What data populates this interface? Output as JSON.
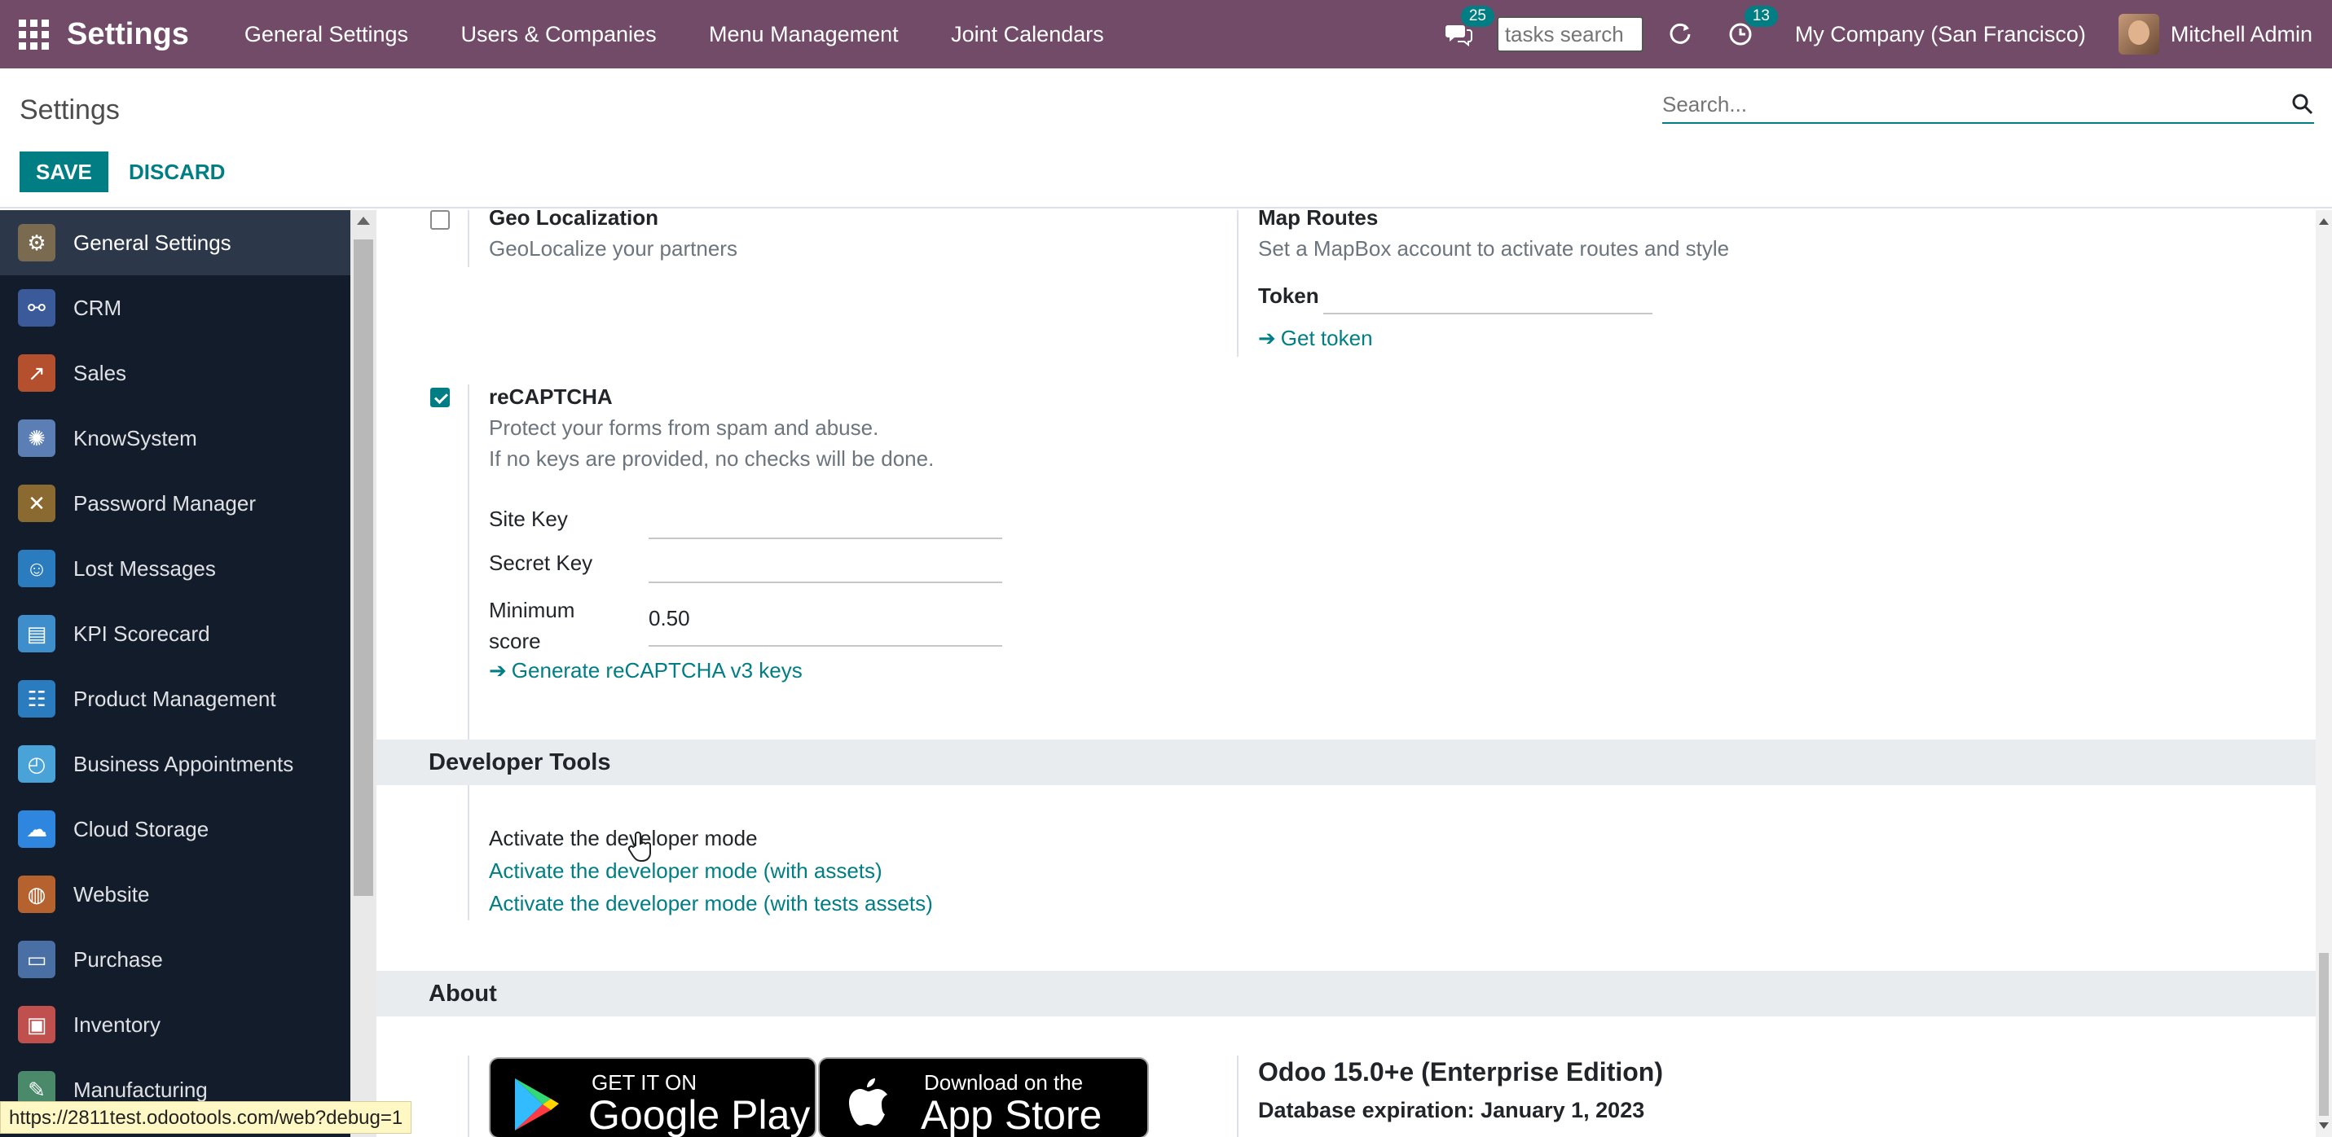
{
  "navbar": {
    "app_title": "Settings",
    "menu": [
      "General Settings",
      "Users & Companies",
      "Menu Management",
      "Joint Calendars"
    ],
    "messages_count": "25",
    "tasks_search_placeholder": "tasks search",
    "activities_count": "13",
    "company": "My Company (San Francisco)",
    "user": "Mitchell Admin"
  },
  "control_panel": {
    "breadcrumb": "Settings",
    "search_placeholder": "Search...",
    "save_label": "SAVE",
    "discard_label": "DISCARD"
  },
  "sidebar": {
    "items": [
      {
        "label": "General Settings",
        "icon": "gear-icon",
        "color": "#7a6a4f",
        "active": true
      },
      {
        "label": "CRM",
        "icon": "handshake-icon",
        "color": "#3a5a9a"
      },
      {
        "label": "Sales",
        "icon": "chart-icon",
        "color": "#b5502e"
      },
      {
        "label": "KnowSystem",
        "icon": "brain-icon",
        "color": "#5b7fb5"
      },
      {
        "label": "Password Manager",
        "icon": "tools-icon",
        "color": "#8a6a30"
      },
      {
        "label": "Lost Messages",
        "icon": "person-icon",
        "color": "#2b7bbf"
      },
      {
        "label": "KPI Scorecard",
        "icon": "clipboard-icon",
        "color": "#3e8ecb"
      },
      {
        "label": "Product Management",
        "icon": "sliders-icon",
        "color": "#2b7bbf"
      },
      {
        "label": "Business Appointments",
        "icon": "clock-icon",
        "color": "#4aa3d8"
      },
      {
        "label": "Cloud Storage",
        "icon": "cloud-icon",
        "color": "#2e86de"
      },
      {
        "label": "Website",
        "icon": "globe-icon",
        "color": "#b5622e"
      },
      {
        "label": "Purchase",
        "icon": "card-icon",
        "color": "#4a6fa5"
      },
      {
        "label": "Inventory",
        "icon": "box-icon",
        "color": "#c0504d"
      },
      {
        "label": "Manufacturing",
        "icon": "wrench-icon",
        "color": "#4a8a6a"
      }
    ]
  },
  "geo": {
    "title": "Geo Localization",
    "description": "GeoLocalize your partners",
    "checked": false
  },
  "map_routes": {
    "title": "Map Routes",
    "description": "Set a MapBox account to activate routes and style",
    "token_label": "Token",
    "token_value": "",
    "get_token": "Get token"
  },
  "recaptcha": {
    "title": "reCAPTCHA",
    "description_1": "Protect your forms from spam and abuse.",
    "description_2": "If no keys are provided, no checks will be done.",
    "checked": true,
    "site_key_label": "Site Key",
    "site_key_value": "",
    "secret_key_label": "Secret Key",
    "secret_key_value": "",
    "min_score_label_1": "Minimum",
    "min_score_label_2": "score",
    "min_score_value": "0.50",
    "generate_link": "Generate reCAPTCHA v3 keys"
  },
  "developer": {
    "section_title": "Developer Tools",
    "activate": "Activate the developer mode",
    "activate_assets": "Activate the developer mode (with assets)",
    "activate_tests": "Activate the developer mode (with tests assets)"
  },
  "about": {
    "section_title": "About",
    "google_small": "GET IT ON",
    "google_big": "Google Play",
    "apple_small": "Download on the",
    "apple_big": "App Store",
    "version": "Odoo 15.0+e (Enterprise Edition)",
    "expiration": "Database expiration: January 1, 2023"
  },
  "status_url": "https://2811test.odootools.com/web?debug=1"
}
